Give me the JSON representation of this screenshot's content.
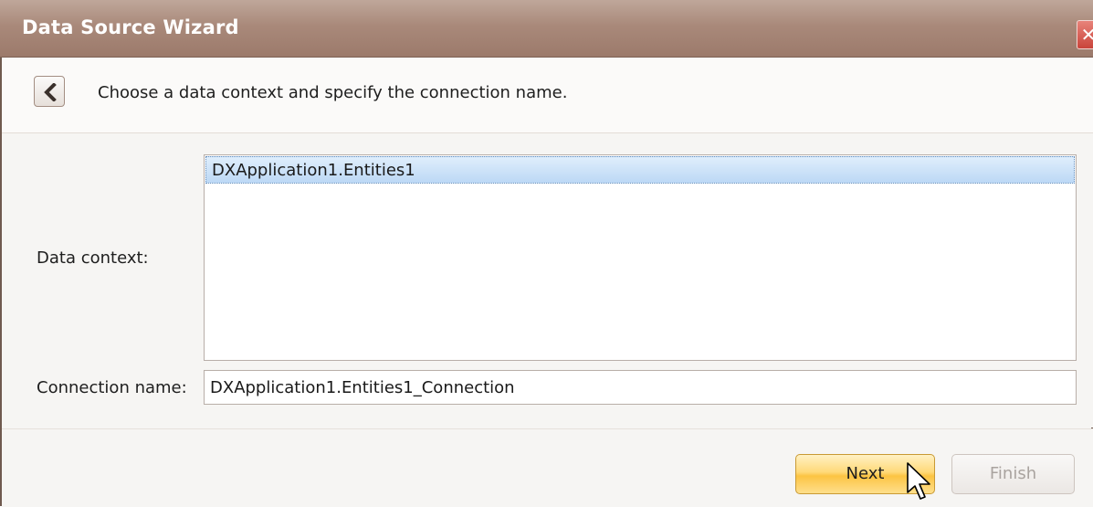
{
  "window": {
    "title": "Data Source Wizard",
    "close_glyph": "✕"
  },
  "header": {
    "back_icon": "chevron-left-icon",
    "instruction": "Choose a data context and specify the connection name."
  },
  "form": {
    "data_context_label": "Data context:",
    "data_context_items": [
      "DXApplication1.Entities1"
    ],
    "selected_item": "DXApplication1.Entities1",
    "connection_name_label": "Connection name:",
    "connection_name_value": "DXApplication1.Entities1_Connection"
  },
  "footer": {
    "next_label": "Next",
    "finish_label": "Finish",
    "finish_enabled": false
  },
  "colors": {
    "titlebar": "#a9897a",
    "selection": "#bcd8f5",
    "next_button": "#ffd978"
  }
}
